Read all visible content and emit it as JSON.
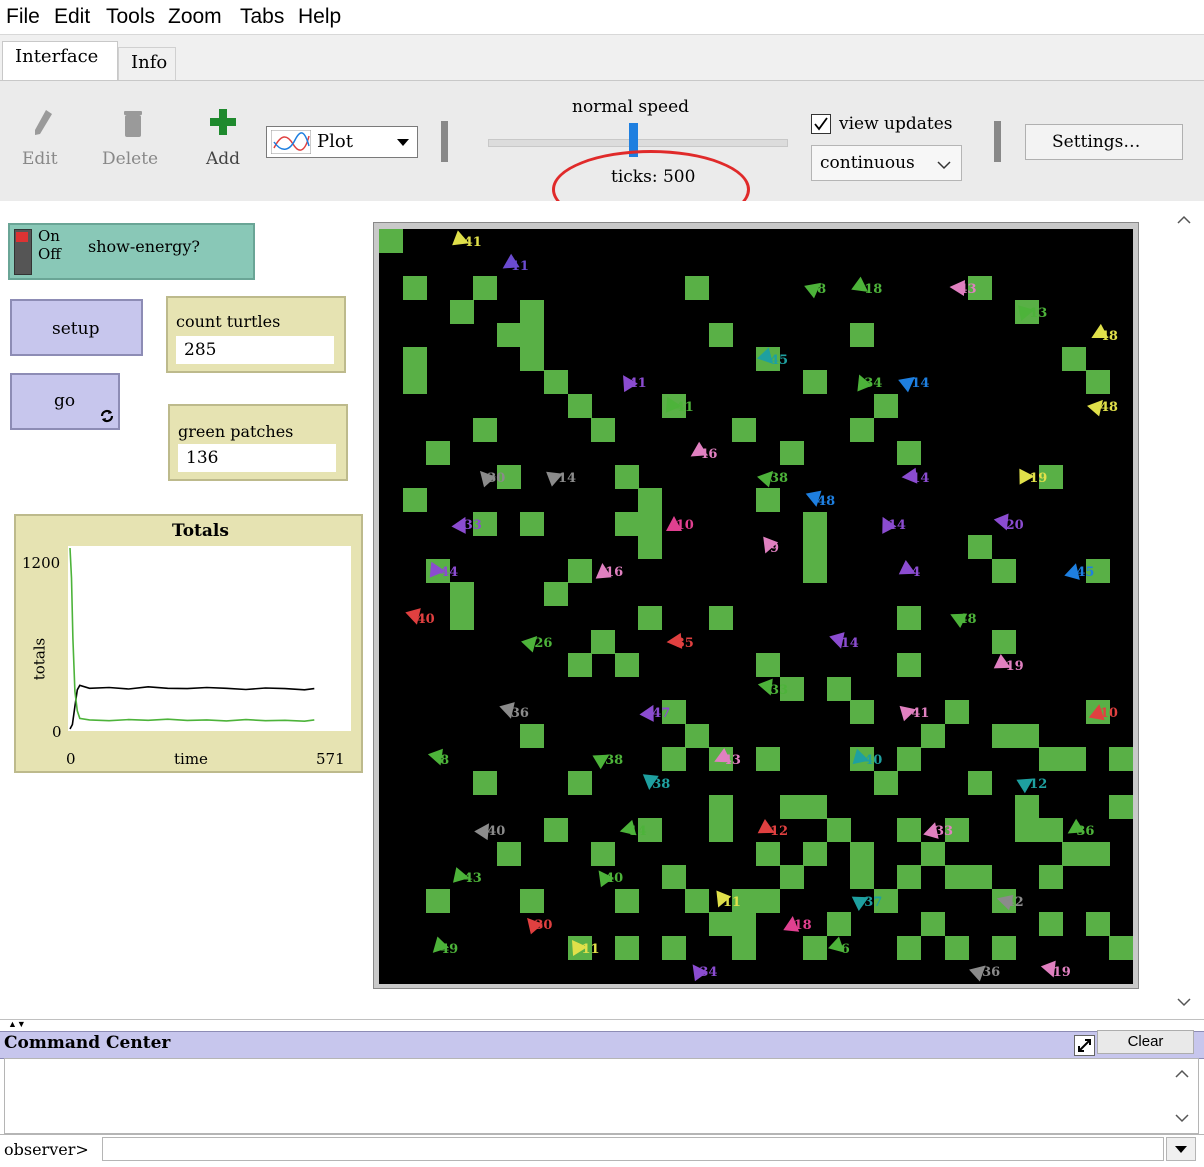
{
  "menu": [
    "File",
    "Edit",
    "Tools",
    "Zoom",
    "Tabs",
    "Help"
  ],
  "tabs": [
    "Interface",
    "Info"
  ],
  "toolbar": {
    "edit_label": "Edit",
    "delete_label": "Delete",
    "add_label": "Add",
    "widget_type": "Plot",
    "speed_label": "normal speed",
    "speed_level": 0.5,
    "ticks_label": "ticks: 500",
    "view_updates_label": "view updates",
    "view_updates_checked": true,
    "update_mode": "continuous",
    "settings_label": "Settings…"
  },
  "widgets": {
    "switch": {
      "label": "show-energy?",
      "on": "On",
      "off": "Off"
    },
    "setup_label": "setup",
    "go_label": "go",
    "monitors": [
      {
        "label": "count turtles",
        "value": "285"
      },
      {
        "label": "green patches",
        "value": "136"
      }
    ],
    "plot": {
      "title": "Totals",
      "xlabel": "time",
      "ylabel": "totals",
      "ymax_label": "1200",
      "ymin_label": "0",
      "xmin_label": "0",
      "xmax_label": "571"
    }
  },
  "chart_data": {
    "type": "line",
    "title": "Totals",
    "xlabel": "time",
    "ylabel": "totals",
    "xlim": [
      0,
      571
    ],
    "ylim": [
      0,
      1200
    ],
    "series": [
      {
        "color": "#000000",
        "x": [
          0,
          5,
          10,
          15,
          20,
          40,
          80,
          120,
          160,
          200,
          240,
          280,
          320,
          360,
          400,
          440,
          480,
          500
        ],
        "y": [
          0,
          30,
          150,
          260,
          290,
          270,
          275,
          265,
          280,
          270,
          268,
          275,
          270,
          262,
          272,
          268,
          260,
          268
        ]
      },
      {
        "color": "#4db33a",
        "x": [
          0,
          3,
          6,
          10,
          15,
          20,
          40,
          80,
          120,
          160,
          200,
          240,
          280,
          320,
          360,
          400,
          440,
          480,
          500
        ],
        "y": [
          1200,
          1000,
          600,
          250,
          120,
          70,
          60,
          55,
          62,
          58,
          65,
          57,
          60,
          54,
          62,
          55,
          58,
          52,
          60
        ]
      }
    ]
  },
  "command_center": {
    "title": "Command Center",
    "clear_label": "Clear",
    "prompt": "observer>"
  },
  "colors": {
    "patch_green": "#59b046",
    "button_purple": "#c7c6ed",
    "monitor_tan": "#e6e3b2",
    "switch_teal": "#89c8b7",
    "annotation_red": "#e02a2a"
  },
  "world": {
    "grid": 32,
    "patches": [
      [
        0,
        0
      ],
      [
        1,
        11
      ],
      [
        5,
        4
      ],
      [
        6,
        4
      ],
      [
        6,
        5
      ],
      [
        7,
        15
      ],
      [
        8,
        23
      ],
      [
        9,
        17
      ],
      [
        10,
        12
      ],
      [
        11,
        11
      ],
      [
        11,
        12
      ],
      [
        11,
        13
      ],
      [
        12,
        7
      ],
      [
        13,
        2
      ],
      [
        14,
        4
      ],
      [
        14,
        22
      ],
      [
        15,
        28
      ],
      [
        15,
        29
      ],
      [
        16,
        5
      ],
      [
        16,
        11
      ],
      [
        17,
        9
      ],
      [
        17,
        24
      ],
      [
        18,
        12
      ],
      [
        18,
        13
      ],
      [
        18,
        14
      ],
      [
        19,
        19
      ],
      [
        20,
        4
      ],
      [
        20,
        20
      ],
      [
        21,
        7
      ],
      [
        22,
        9
      ],
      [
        22,
        16
      ],
      [
        22,
        25
      ],
      [
        23,
        29
      ],
      [
        24,
        30
      ],
      [
        25,
        2
      ],
      [
        25,
        13
      ],
      [
        26,
        17
      ],
      [
        27,
        3
      ],
      [
        27,
        21
      ],
      [
        28,
        27
      ],
      [
        29,
        5
      ],
      [
        30,
        14
      ],
      [
        31,
        30
      ],
      [
        1,
        5
      ],
      [
        1,
        6
      ],
      [
        2,
        14
      ],
      [
        3,
        15
      ],
      [
        4,
        23
      ],
      [
        5,
        26
      ],
      [
        6,
        21
      ],
      [
        7,
        25
      ],
      [
        8,
        18
      ],
      [
        9,
        8
      ],
      [
        10,
        10
      ],
      [
        11,
        16
      ],
      [
        12,
        27
      ],
      [
        13,
        28
      ],
      [
        14,
        25
      ],
      [
        15,
        8
      ],
      [
        16,
        18
      ],
      [
        17,
        19
      ],
      [
        18,
        26
      ],
      [
        19,
        25
      ],
      [
        20,
        26
      ],
      [
        21,
        23
      ],
      [
        22,
        27
      ],
      [
        23,
        21
      ],
      [
        24,
        25
      ],
      [
        25,
        27
      ],
      [
        26,
        21
      ],
      [
        27,
        24
      ],
      [
        28,
        25
      ],
      [
        29,
        22
      ],
      [
        30,
        20
      ],
      [
        31,
        22
      ],
      [
        1,
        2
      ],
      [
        2,
        9
      ],
      [
        3,
        16
      ],
      [
        4,
        8
      ],
      [
        5,
        10
      ],
      [
        6,
        3
      ],
      [
        7,
        6
      ],
      [
        8,
        7
      ],
      [
        9,
        26
      ],
      [
        10,
        30
      ],
      [
        11,
        25
      ],
      [
        12,
        22
      ],
      [
        13,
        21
      ],
      [
        14,
        29
      ],
      [
        15,
        30
      ],
      [
        16,
        26
      ],
      [
        17,
        27
      ],
      [
        18,
        24
      ],
      [
        19,
        29
      ],
      [
        20,
        27
      ],
      [
        21,
        28
      ],
      [
        22,
        30
      ],
      [
        23,
        26
      ],
      [
        24,
        27
      ],
      [
        25,
        23
      ],
      [
        26,
        28
      ],
      [
        27,
        25
      ],
      [
        28,
        29
      ],
      [
        29,
        26
      ],
      [
        30,
        29
      ],
      [
        31,
        24
      ],
      [
        3,
        3
      ],
      [
        4,
        12
      ],
      [
        6,
        12
      ],
      [
        8,
        14
      ],
      [
        10,
        18
      ],
      [
        12,
        20
      ],
      [
        14,
        16
      ],
      [
        16,
        22
      ],
      [
        18,
        6
      ],
      [
        20,
        8
      ],
      [
        22,
        18
      ],
      [
        24,
        20
      ],
      [
        26,
        14
      ],
      [
        28,
        10
      ],
      [
        30,
        6
      ],
      [
        2,
        28
      ],
      [
        4,
        2
      ],
      [
        6,
        28
      ],
      [
        8,
        30
      ],
      [
        10,
        28
      ],
      [
        12,
        30
      ],
      [
        14,
        24
      ],
      [
        16,
        28
      ],
      [
        18,
        30
      ],
      [
        20,
        22
      ],
      [
        22,
        22
      ],
      [
        24,
        30
      ],
      [
        26,
        30
      ],
      [
        28,
        22
      ],
      [
        30,
        26
      ]
    ],
    "turtles": [
      [
        3,
        0,
        "#e0e04a",
        "41"
      ],
      [
        5,
        1,
        "#6b4bd0",
        "11"
      ],
      [
        18,
        2,
        "#4db33a",
        "8"
      ],
      [
        20,
        2,
        "#4db33a",
        "18"
      ],
      [
        24,
        2,
        "#e080c0",
        "43"
      ],
      [
        27,
        3,
        "#4db33a",
        "13"
      ],
      [
        16,
        5,
        "#1ea0a0",
        "45"
      ],
      [
        10,
        6,
        "#8b4cd0",
        "41"
      ],
      [
        12,
        7,
        "#4db33a",
        "41"
      ],
      [
        20,
        6,
        "#4db33a",
        "34"
      ],
      [
        22,
        6,
        "#1e7fe0",
        "14"
      ],
      [
        30,
        7,
        "#e0e04a",
        "48"
      ],
      [
        4,
        10,
        "#8b8b8b",
        "30"
      ],
      [
        7,
        10,
        "#8b8b8b",
        "14"
      ],
      [
        13,
        9,
        "#e080c0",
        "46"
      ],
      [
        16,
        10,
        "#4db33a",
        "38"
      ],
      [
        22,
        10,
        "#8b4cd0",
        "14"
      ],
      [
        27,
        10,
        "#e0e04a",
        "19"
      ],
      [
        3,
        12,
        "#8b4cd0",
        "33"
      ],
      [
        12,
        12,
        "#e04090",
        "10"
      ],
      [
        18,
        11,
        "#1e7fe0",
        "48"
      ],
      [
        21,
        12,
        "#8b4cd0",
        "14"
      ],
      [
        26,
        12,
        "#8b4cd0",
        "20"
      ],
      [
        2,
        14,
        "#8b4cd0",
        "44"
      ],
      [
        9,
        14,
        "#e080c0",
        "16"
      ],
      [
        16,
        13,
        "#e080c0",
        "9"
      ],
      [
        22,
        14,
        "#8b4cd0",
        "4"
      ],
      [
        29,
        14,
        "#1e7fe0",
        "45"
      ],
      [
        6,
        17,
        "#4db33a",
        "26"
      ],
      [
        12,
        17,
        "#e04040",
        "35"
      ],
      [
        19,
        17,
        "#8b4cd0",
        "14"
      ],
      [
        26,
        18,
        "#e080c0",
        "19"
      ],
      [
        5,
        20,
        "#8b8b8b",
        "36"
      ],
      [
        11,
        20,
        "#8b4cd0",
        "47"
      ],
      [
        16,
        19,
        "#4db33a",
        "33"
      ],
      [
        22,
        20,
        "#e080c0",
        "41"
      ],
      [
        30,
        20,
        "#e04040",
        "10"
      ],
      [
        2,
        22,
        "#4db33a",
        "8"
      ],
      [
        9,
        22,
        "#4db33a",
        "38"
      ],
      [
        14,
        22,
        "#e080c0",
        "43"
      ],
      [
        20,
        22,
        "#1ea0a0",
        "40"
      ],
      [
        27,
        23,
        "#1ea0a0",
        "12"
      ],
      [
        4,
        25,
        "#8b8b8b",
        "40"
      ],
      [
        10,
        25,
        "#4db33a",
        "14"
      ],
      [
        16,
        25,
        "#e04040",
        "12"
      ],
      [
        23,
        25,
        "#e080c0",
        "33"
      ],
      [
        29,
        25,
        "#4db33a",
        "36"
      ],
      [
        3,
        27,
        "#4db33a",
        "43"
      ],
      [
        9,
        27,
        "#4db33a",
        "40"
      ],
      [
        14,
        28,
        "#e0e04a",
        "11"
      ],
      [
        20,
        28,
        "#1ea0a0",
        "37"
      ],
      [
        26,
        28,
        "#8b8b8b",
        "42"
      ],
      [
        2,
        30,
        "#4db33a",
        "49"
      ],
      [
        8,
        30,
        "#e0e04a",
        "11"
      ],
      [
        13,
        31,
        "#8b4cd0",
        "34"
      ],
      [
        19,
        30,
        "#4db33a",
        "6"
      ],
      [
        25,
        31,
        "#8b8b8b",
        "36"
      ],
      [
        28,
        31,
        "#e080c0",
        "19"
      ],
      [
        6,
        29,
        "#e04040",
        "30"
      ],
      [
        17,
        29,
        "#e04090",
        "18"
      ],
      [
        11,
        23,
        "#1ea0a0",
        "38"
      ],
      [
        24,
        16,
        "#4db33a",
        "48"
      ],
      [
        1,
        16,
        "#e04040",
        "40"
      ],
      [
        30,
        4,
        "#e0e04a",
        "48"
      ]
    ]
  }
}
